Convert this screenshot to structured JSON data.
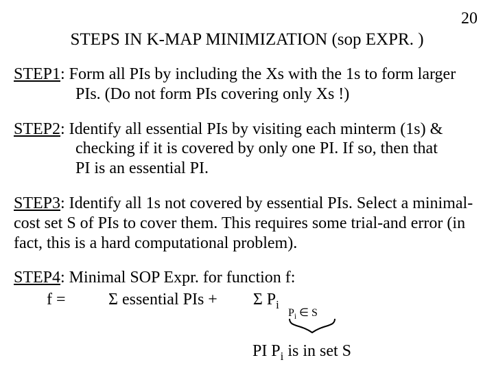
{
  "page_number": "20",
  "title": "STEPS IN K-MAP MINIMIZATION (sop EXPR. )",
  "steps": {
    "s1": {
      "label": "STEP1",
      "line1": ":  Form all PIs by including the Xs with the 1s to form larger",
      "line2": "PIs.  (Do not form PIs covering only Xs !)"
    },
    "s2": {
      "label": "STEP2",
      "line1": ":  Identify all essential PIs by visiting each minterm (1s) &",
      "line2": "checking if it is covered by only one PI.  If so, then that",
      "line3": "PI is an essential PI."
    },
    "s3": {
      "label": "STEP3",
      "line1": ":  Identify all 1s not covered by essential PIs.  Select a minimal-",
      "line2": "cost set S of PIs to cover them.  This requires some trial-and error (in",
      "line3": "fact, this is a hard computational problem)."
    },
    "s4": {
      "label": "STEP4",
      "line1": ":  Minimal SOP Expr. for function f:"
    }
  },
  "formula": {
    "f_eq": "f =",
    "sigma1_text": "Σ essential PIs   +",
    "sigma2_text": "Σ  P",
    "sigma2_sub": "i",
    "cond_left": "P",
    "cond_left_sub": "i",
    "cond_mid": " ∈ S",
    "note_prefix": "PI P",
    "note_sub": "i",
    "note_suffix": " is in set S"
  }
}
